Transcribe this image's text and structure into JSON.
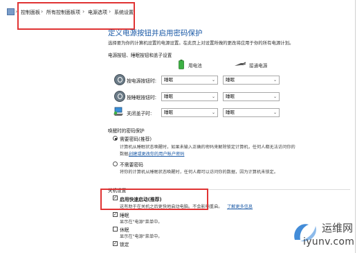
{
  "breadcrumb": {
    "items": [
      "控制面板",
      "所有控制面板项",
      "电源选项",
      "系统设置"
    ],
    "separator": "›"
  },
  "page": {
    "heading": "定义电源按钮并启用密码保护",
    "description": "选择要为你的计算机设置的电源设置。在此页上对设置所做的更改将应用于你的所有电源计划。"
  },
  "buttons_section": {
    "title": "电源按钮、睡眠按钮和盖子设置",
    "col_battery": "用电池",
    "col_plugged": "接通电源",
    "rows": [
      {
        "label": "按电源按钮时:",
        "battery": "睡眠",
        "plugged": "睡眠"
      },
      {
        "label": "按睡眠按钮时:",
        "battery": "睡眠",
        "plugged": "睡眠"
      },
      {
        "label": "关闭盖子时:",
        "battery": "睡眠",
        "plugged": "睡眠"
      }
    ]
  },
  "password_section": {
    "title": "唤醒时的密码保护",
    "require": {
      "label": "需要密码(推荐)",
      "line1": "计算机从睡眠状态唤醒时，如果未输入正确的密码来解除锁定计算机，任何人都无法访问你的",
      "line2_text": "数据。",
      "link": "创建或更改你的用户帐户密码"
    },
    "no_require": {
      "label": "不需要密码",
      "line1": "将你的计算机从睡眠状态唤醒时，任何人都可以访问你的数据，因为计算机未锁定。"
    }
  },
  "shutdown_section": {
    "title": "关机设置",
    "fast_startup": {
      "label": "启用快速启动(推荐)",
      "desc": "这有助于在关机之后更快地启动电脑。不会影响重启。",
      "link": "了解更多信息",
      "checked": true
    },
    "sleep": {
      "label": "睡眠",
      "desc": "显示在\"电源\"菜单中。",
      "checked": true
    },
    "hibernate": {
      "label": "休眠",
      "desc": "显示在\"电源\"菜单中。",
      "checked": false
    },
    "lock": {
      "label": "锁定",
      "checked": true
    }
  },
  "watermark": {
    "cn": "运维网",
    "url": "iyunv.com"
  },
  "colors": {
    "heading": "#1a59a6",
    "highlight": "#e03232",
    "battery_green": "#3cb043"
  }
}
